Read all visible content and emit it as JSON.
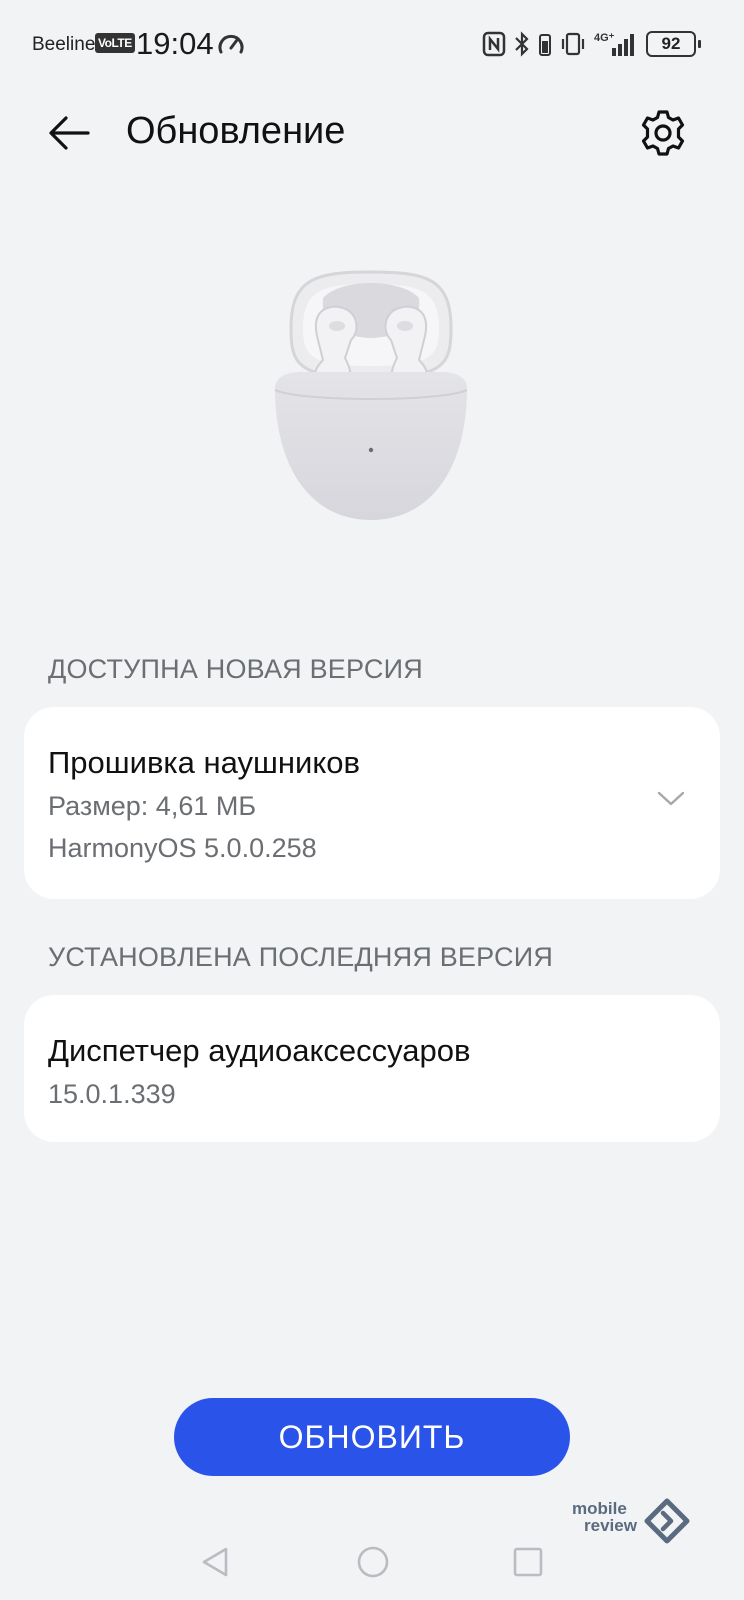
{
  "status_bar": {
    "carrier": "Beeline",
    "volte": "VoLTE",
    "time": "19:04",
    "network": "4G⁺",
    "battery": "92"
  },
  "header": {
    "title": "Обновление"
  },
  "sections": {
    "available_label": "ДОСТУПНА НОВАЯ ВЕРСИЯ",
    "installed_label": "УСТАНОВЛЕНА ПОСЛЕДНЯЯ ВЕРСИЯ"
  },
  "firmware": {
    "title": "Прошивка наушников",
    "size": "Размер: 4,61 МБ",
    "version": "HarmonyOS 5.0.0.258"
  },
  "audio_manager": {
    "title": "Диспетчер аудиоаксессуаров",
    "version": "15.0.1.339"
  },
  "update_button": {
    "label": "ОБНОВИТЬ"
  },
  "watermark": {
    "line1": "mobile",
    "line2": "review"
  },
  "colors": {
    "background": "#f1f3f5",
    "accent": "#2a53e9",
    "card": "#ffffff",
    "secondary_text": "#6b6e72"
  }
}
